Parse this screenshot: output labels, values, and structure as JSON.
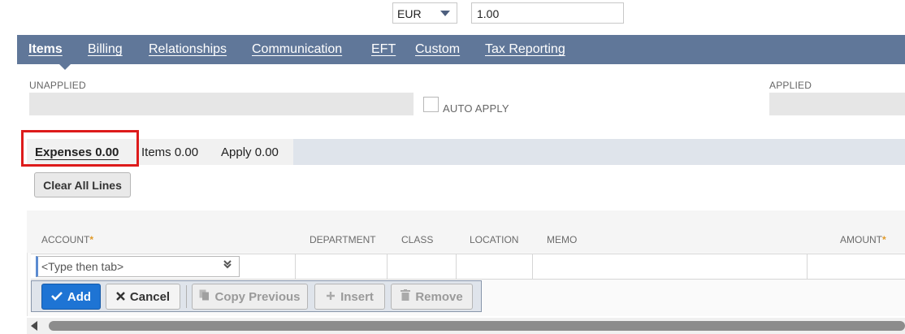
{
  "currency": {
    "value": "EUR",
    "exchange_rate": "1.00"
  },
  "main_tabs": [
    {
      "label": "Items",
      "active": true
    },
    {
      "label": "Billing"
    },
    {
      "label": "Relationships"
    },
    {
      "label": "Communication"
    },
    {
      "label": "EFT"
    },
    {
      "label": "Custom"
    },
    {
      "label": "Tax Reporting"
    }
  ],
  "fields": {
    "unapplied_label": "UNAPPLIED",
    "applied_label": "APPLIED",
    "auto_apply_label": "AUTO APPLY"
  },
  "sub_tabs": [
    {
      "label": "Expenses 0.00",
      "active": true
    },
    {
      "label": "Items 0.00"
    },
    {
      "label": "Apply 0.00"
    }
  ],
  "clear_all_label": "Clear All Lines",
  "grid": {
    "columns": [
      "ACCOUNT",
      "DEPARTMENT",
      "CLASS",
      "LOCATION",
      "MEMO",
      "AMOUNT"
    ],
    "required_mark": "*",
    "account_placeholder": "<Type then tab>"
  },
  "actions": {
    "add": "Add",
    "cancel": "Cancel",
    "copy_previous": "Copy Previous",
    "insert": "Insert",
    "remove": "Remove"
  },
  "colors": {
    "tab_bar": "#607799",
    "highlight": "#dd1b1b",
    "add_button": "#1e74d4",
    "required": "#e09a2a"
  }
}
